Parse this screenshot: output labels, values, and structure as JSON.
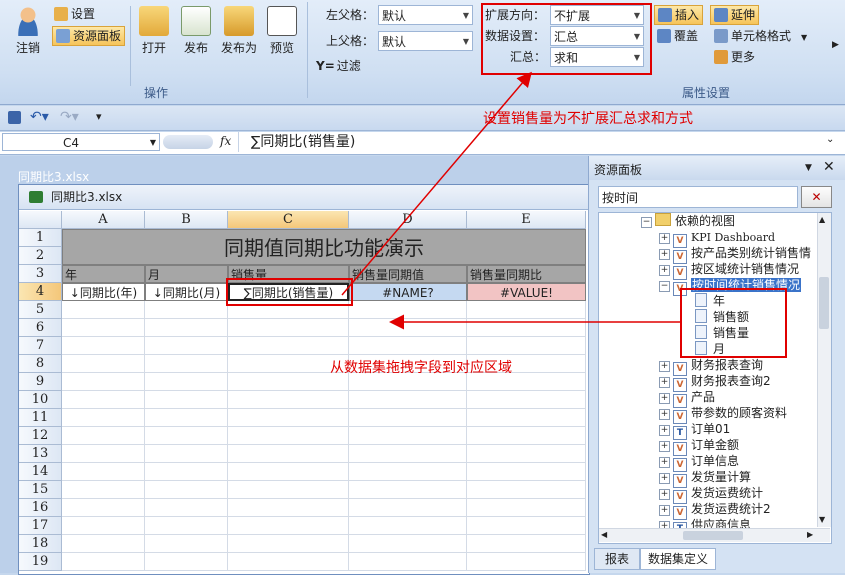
{
  "ribbon": {
    "logout": "注销",
    "settings": "设置",
    "resource_panel": "资源面板",
    "open": "打开",
    "publish": "发布",
    "publish_as": "发布为",
    "preview": "预览",
    "group_ops": "操作",
    "left_parent_label": "左父格：",
    "left_parent_value": "默认",
    "top_parent_label": "上父格：",
    "top_parent_value": "默认",
    "filter": "过滤",
    "expand_dir_label": "扩展方向：",
    "expand_dir_value": "不扩展",
    "data_setting_label": "数据设置：",
    "data_setting_value": "汇总",
    "summary_label": "汇总：",
    "summary_value": "求和",
    "insert": "插入",
    "extend": "延伸",
    "cover": "覆盖",
    "cell_format": "单元格格式",
    "more": "更多",
    "group_props": "属性设置"
  },
  "formula_bar": {
    "cell_ref": "C4",
    "fx": "fx",
    "formula": "∑同期比(销售量)"
  },
  "bg_window_title": "同期比3.xlsx",
  "workbook": {
    "title": "同期比3.xlsx",
    "columns": [
      "A",
      "B",
      "C",
      "D",
      "E"
    ],
    "rows": [
      "1",
      "2",
      "3",
      "4",
      "5",
      "6",
      "7",
      "8",
      "9",
      "10",
      "11",
      "12",
      "13",
      "14",
      "15",
      "16",
      "17",
      "18",
      "19"
    ],
    "header_title": "同期值同期比功能演示",
    "row3": [
      "年",
      "月",
      "销售量",
      "销售量同期值",
      "销售量同期比"
    ],
    "row4": [
      "↓同期比(年)",
      "↓同期比(月)",
      "∑同期比(销售量)",
      "#NAME?",
      "#VALUE!"
    ]
  },
  "panel": {
    "title": "资源面板",
    "search_value": "按时间",
    "tree": [
      {
        "label": "依赖的视图",
        "type": "folder"
      },
      {
        "label": "KPI Dashboard",
        "type": "view"
      },
      {
        "label": "按产品类别统计销售情",
        "type": "view"
      },
      {
        "label": "按区域统计销售情况",
        "type": "view"
      },
      {
        "label": "按时间统计销售情况",
        "type": "view-selected"
      },
      {
        "label": "年",
        "type": "field"
      },
      {
        "label": "销售额",
        "type": "field"
      },
      {
        "label": "销售量",
        "type": "field"
      },
      {
        "label": "月",
        "type": "field"
      },
      {
        "label": "财务报表查询",
        "type": "view"
      },
      {
        "label": "财务报表查询2",
        "type": "view"
      },
      {
        "label": "产品",
        "type": "view"
      },
      {
        "label": "带参数的顾客资料",
        "type": "view"
      },
      {
        "label": "订单01",
        "type": "table"
      },
      {
        "label": "订单金额",
        "type": "view"
      },
      {
        "label": "订单信息",
        "type": "view"
      },
      {
        "label": "发货量计算",
        "type": "view"
      },
      {
        "label": "发货运费统计",
        "type": "view"
      },
      {
        "label": "发货运费统计2",
        "type": "view"
      },
      {
        "label": "供应商信息",
        "type": "table"
      }
    ],
    "tabs": [
      "报表",
      "数据集定义"
    ]
  },
  "annotations": {
    "top": "设置销售量为不扩展汇总求和方式",
    "middle": "从数据集拖拽字段到对应区域"
  },
  "colors": {
    "accent_red": "#e00000",
    "header_gray": "#a6a6a6",
    "blue_cell": "#c5d9f1",
    "pink_cell": "#f2c4c4"
  }
}
